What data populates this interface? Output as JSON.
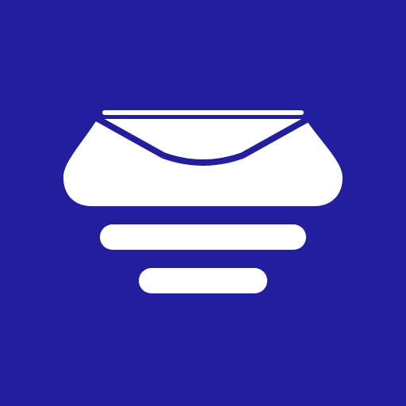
{
  "app_icon": {
    "icon_name": "mail-tray-icon",
    "background_color": "#221e9e",
    "foreground_color": "#ffffff"
  }
}
